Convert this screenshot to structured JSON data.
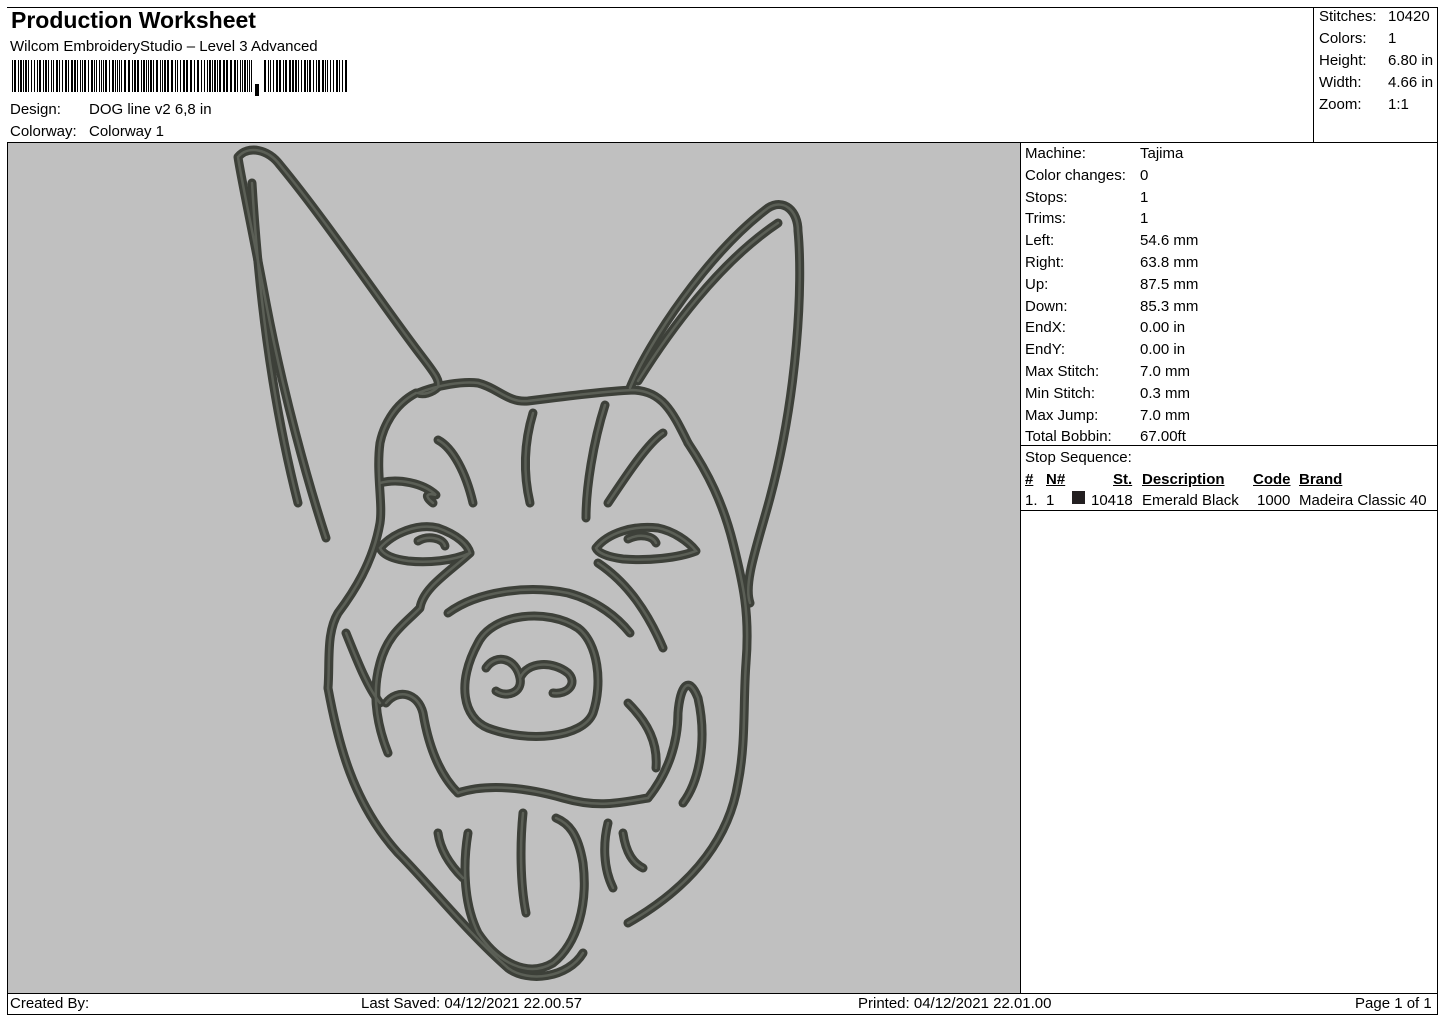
{
  "header": {
    "title": "Production Worksheet",
    "software": "Wilcom EmbroideryStudio – Level 3 Advanced",
    "design_label": "Design:",
    "design_value": "DOG line v2 6,8 in",
    "colorway_label": "Colorway:",
    "colorway_value": "Colorway 1"
  },
  "summary": [
    {
      "label": "Stitches:",
      "value": "10420"
    },
    {
      "label": "Colors:",
      "value": "1"
    },
    {
      "label": "Height:",
      "value": "6.80 in"
    },
    {
      "label": "Width:",
      "value": "4.66 in"
    },
    {
      "label": "Zoom:",
      "value": "1:1"
    }
  ],
  "machine_info": [
    {
      "label": "Machine:",
      "value": "Tajima"
    },
    {
      "label": "Color changes:",
      "value": "0"
    },
    {
      "label": "Stops:",
      "value": "1"
    },
    {
      "label": "Trims:",
      "value": "1"
    },
    {
      "label": "Left:",
      "value": "54.6 mm"
    },
    {
      "label": "Right:",
      "value": "63.8 mm"
    },
    {
      "label": "Up:",
      "value": "87.5 mm"
    },
    {
      "label": "Down:",
      "value": "85.3 mm"
    },
    {
      "label": "EndX:",
      "value": "0.00 in"
    },
    {
      "label": "EndY:",
      "value": "0.00 in"
    },
    {
      "label": "Max Stitch:",
      "value": "7.0 mm"
    },
    {
      "label": "Min Stitch:",
      "value": "0.3 mm"
    },
    {
      "label": "Max Jump:",
      "value": "7.0 mm"
    },
    {
      "label": "Total Bobbin:",
      "value": "67.00ft"
    }
  ],
  "stop_sequence": {
    "title": "Stop Sequence:",
    "headers": {
      "num": "#",
      "needle": "N#",
      "stitches": "St.",
      "description": "Description",
      "code": "Code",
      "brand": "Brand"
    },
    "rows": [
      {
        "num": "1.",
        "needle": "1",
        "color": "#231f20",
        "stitches": "10418",
        "description": "Emerald Black",
        "code": "1000",
        "brand": "Madeira Classic 40"
      }
    ]
  },
  "design_preview": {
    "background": "#c0c0c0",
    "thread_color": "#3d4039"
  },
  "footer": {
    "created_by": "Created By:",
    "last_saved": "Last Saved: 04/12/2021 22.00.57",
    "printed": "Printed: 04/12/2021 22.01.00",
    "page": "Page 1 of 1"
  }
}
